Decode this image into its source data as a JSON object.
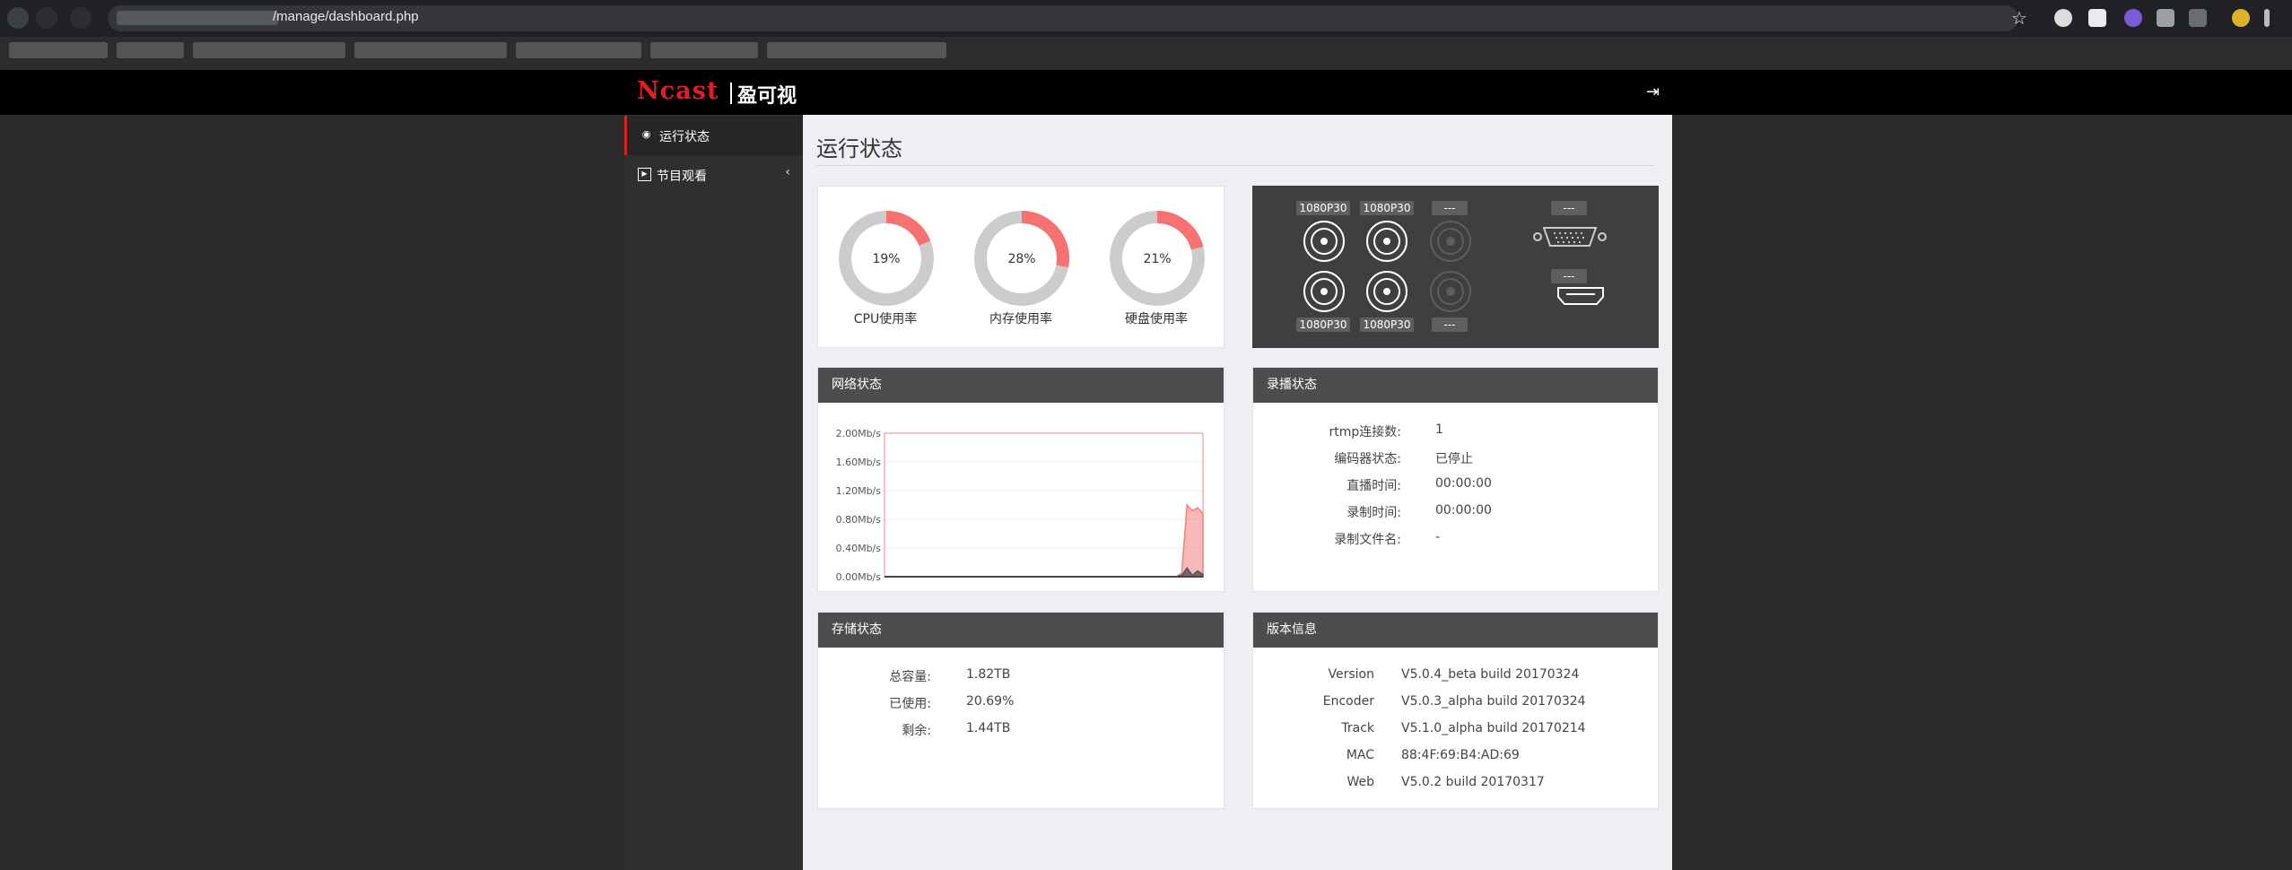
{
  "browser": {
    "url_path": "/manage/dashboard.php"
  },
  "header": {
    "brand_en": "Ncast",
    "brand_cn": "盈可视"
  },
  "sidebar": {
    "items": [
      {
        "label": "运行状态"
      },
      {
        "label": "节目观看"
      }
    ]
  },
  "page_title": "运行状态",
  "gauges": [
    {
      "label": "CPU使用率",
      "percent": 19,
      "text": "19%"
    },
    {
      "label": "内存使用率",
      "percent": 28,
      "text": "28%"
    },
    {
      "label": "硬盘使用率",
      "percent": 21,
      "text": "21%"
    }
  ],
  "video_inputs": {
    "top_labels": [
      "1080P30",
      "1080P30",
      "---"
    ],
    "bottom_labels": [
      "1080P30",
      "1080P30",
      "---"
    ],
    "vga_label": "---",
    "hdmi_label": "---"
  },
  "network": {
    "title": "网络状态"
  },
  "chart_data": {
    "type": "area",
    "title": "",
    "xlabel": "",
    "ylabel": "",
    "ylim": [
      0,
      2.0
    ],
    "y_ticks": [
      "2.00Mb/s",
      "1.60Mb/s",
      "1.20Mb/s",
      "0.80Mb/s",
      "0.40Mb/s",
      "0.00Mb/s"
    ],
    "grid": true,
    "x": [
      0,
      5,
      10,
      15,
      20,
      25,
      30,
      35,
      40,
      45,
      50,
      55,
      56,
      57,
      58,
      59,
      60
    ],
    "series": [
      {
        "values": [
          0,
          0,
          0,
          0,
          0,
          0,
          0,
          0,
          0,
          0,
          0,
          0,
          0.05,
          1.0,
          0.92,
          0.96,
          0.88
        ],
        "color": "#f28080"
      },
      {
        "values": [
          0,
          0,
          0,
          0,
          0,
          0,
          0,
          0,
          0,
          0,
          0,
          0,
          0.02,
          0.12,
          0.02,
          0.08,
          0.03
        ],
        "color": "#555555"
      }
    ],
    "accent": "#f28080"
  },
  "record": {
    "title": "录播状态",
    "rows": [
      {
        "key": "rtmp连接数:",
        "value": "1"
      },
      {
        "key": "编码器状态:",
        "value": "已停止"
      },
      {
        "key": "直播时间:",
        "value": "00:00:00"
      },
      {
        "key": "录制时间:",
        "value": "00:00:00"
      },
      {
        "key": "录制文件名:",
        "value": "-"
      }
    ]
  },
  "storage": {
    "title": "存储状态",
    "rows": [
      {
        "key": "总容量:",
        "value": "1.82TB"
      },
      {
        "key": "已使用:",
        "value": "20.69%"
      },
      {
        "key": "剩余:",
        "value": "1.44TB"
      }
    ]
  },
  "version": {
    "title": "版本信息",
    "rows": [
      {
        "key": "Version",
        "value": "V5.0.4_beta build 20170324"
      },
      {
        "key": "Encoder",
        "value": "V5.0.3_alpha build 20170324"
      },
      {
        "key": "Track",
        "value": "V5.1.0_alpha build 20170214"
      },
      {
        "key": "MAC",
        "value": "88:4F:69:B4:AD:69"
      },
      {
        "key": "Web",
        "value": "V5.0.2 build 20170317"
      }
    ]
  },
  "colors": {
    "accent": "#f87171",
    "sidebar_active": "#e02020",
    "brand_red": "#e51c23"
  }
}
